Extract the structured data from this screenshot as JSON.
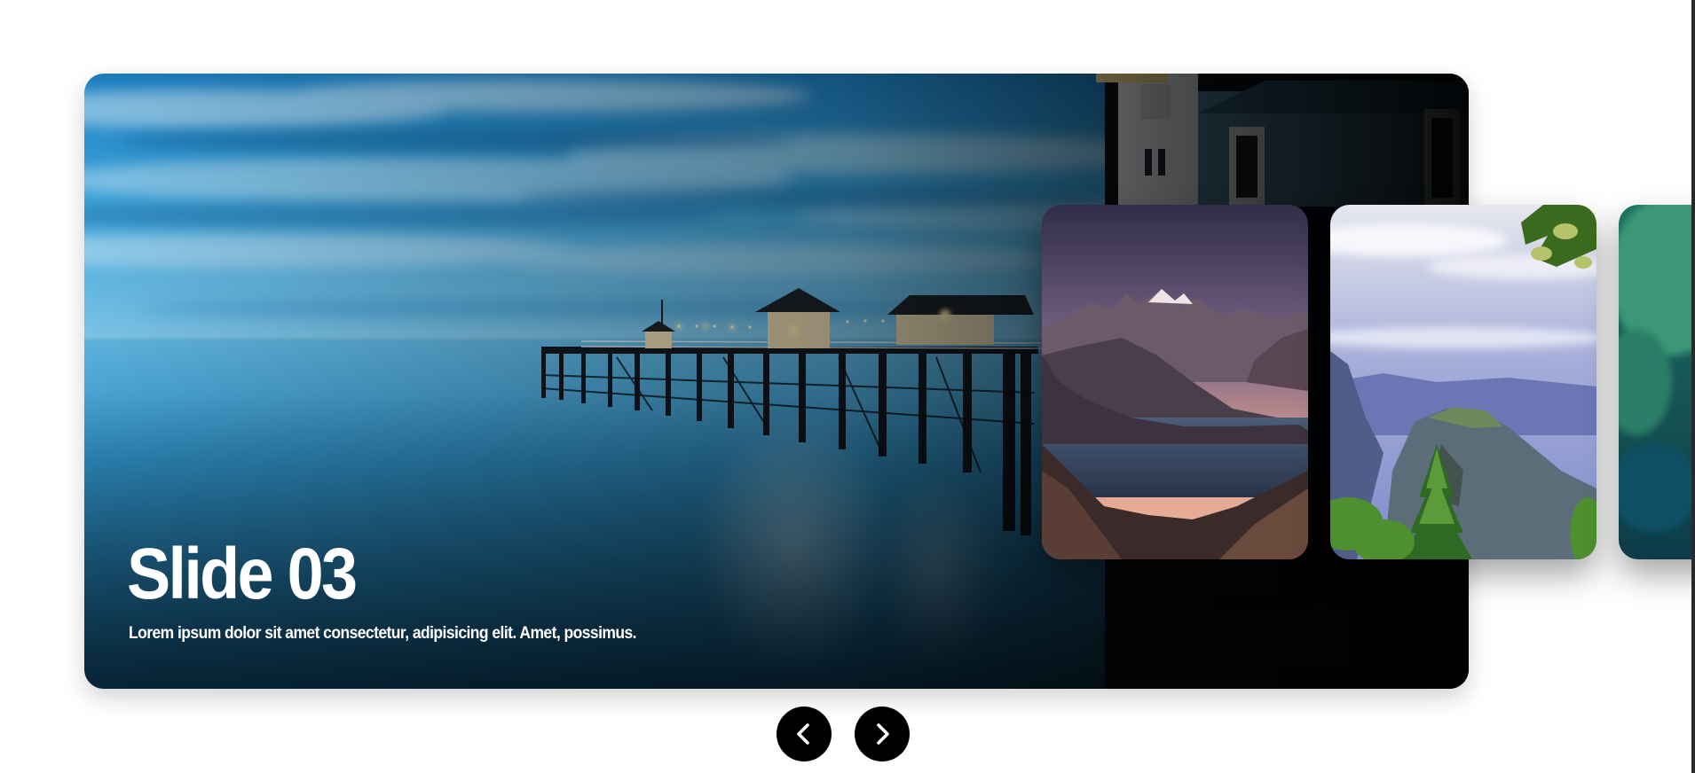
{
  "slider": {
    "active_slide": {
      "title": "Slide 03",
      "description": "Lorem ipsum dolor sit amet consectetur, adipisicing elit. Amet, possimus."
    },
    "controls": {
      "prev_icon": "chevron-left-icon",
      "next_icon": "chevron-right-icon"
    }
  },
  "colors": {
    "button_background": "#000000",
    "button_icon": "#ffffff",
    "text": "#ffffff",
    "page_background": "#ffffff"
  }
}
